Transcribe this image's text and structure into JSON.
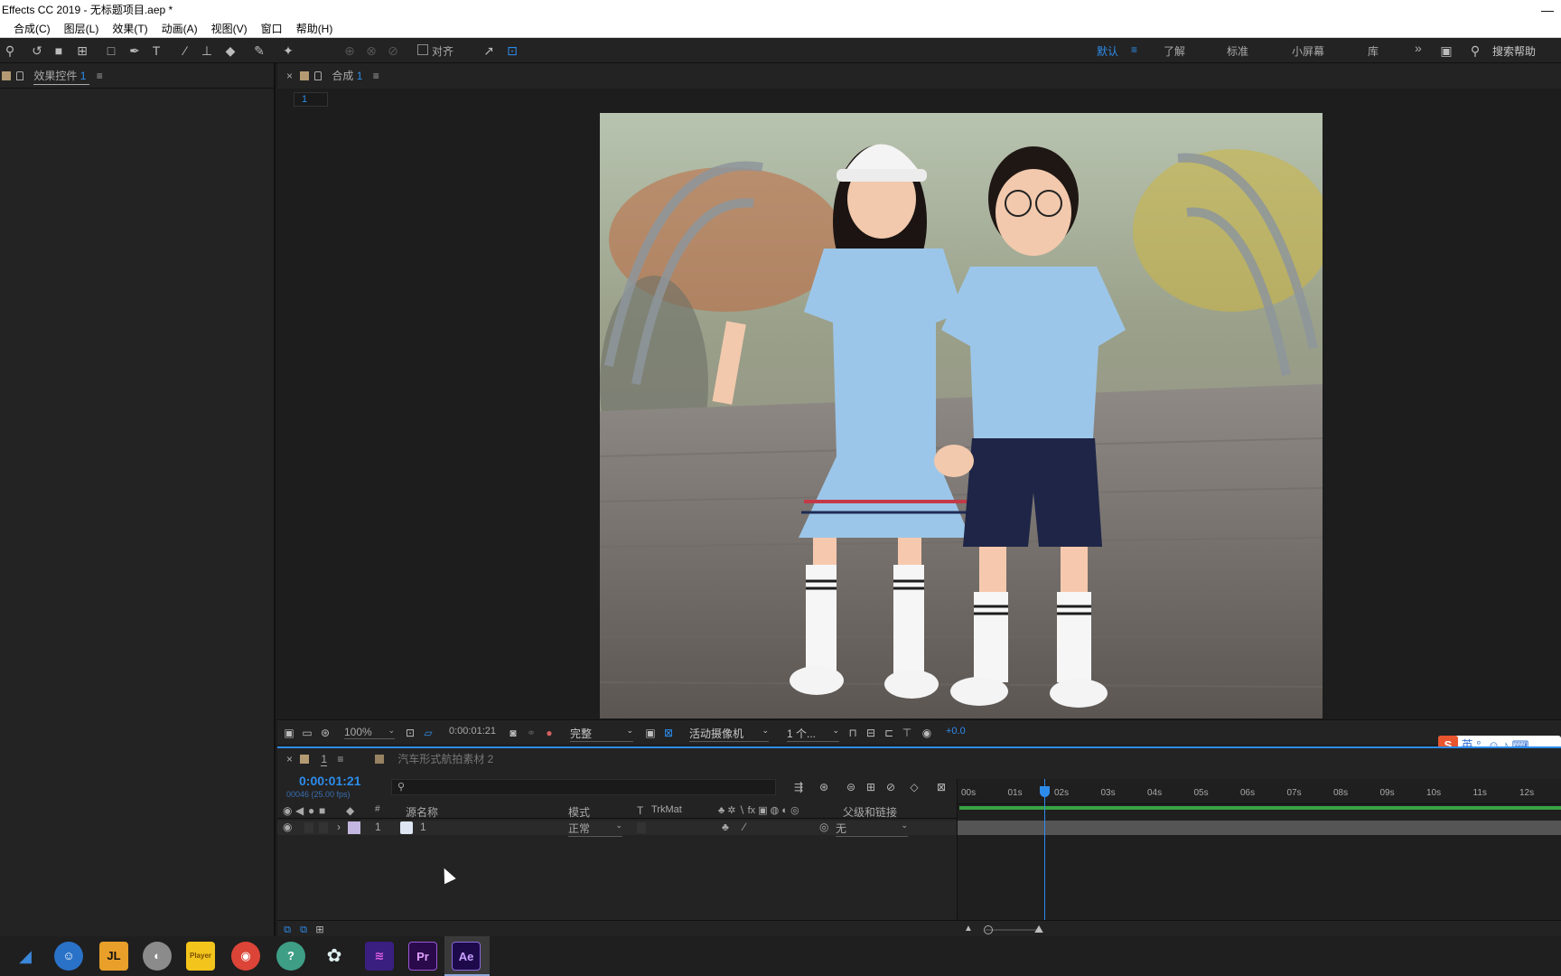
{
  "window": {
    "title": "Effects CC 2019 - 无标题项目.aep *",
    "minimize": "—"
  },
  "menu": [
    "合成(C)",
    "图层(L)",
    "效果(T)",
    "动画(A)",
    "视图(V)",
    "窗口",
    "帮助(H)"
  ],
  "toolbar": {
    "align_label": "对齐",
    "workspaces": [
      "默认",
      "了解",
      "标准",
      "小屏幕",
      "库"
    ],
    "more": "»",
    "search_placeholder": "搜索帮助"
  },
  "left_panel": {
    "tab_label": "效果控件",
    "tab_number": "1",
    "menu": "≡"
  },
  "comp_panel": {
    "close": "×",
    "tab_label": "合成",
    "tab_number": "1",
    "menu": "≡",
    "sub_tab": "1"
  },
  "viewer_bar": {
    "zoom": "100%",
    "timecode": "0:00:01:21",
    "resolution": "完整",
    "camera": "活动摄像机",
    "views": "1 个...",
    "exposure": "+0.0"
  },
  "timeline": {
    "close": "×",
    "tab_number": "1",
    "menu": "≡",
    "other_tab": "汽车形式航拍素材 2",
    "current_time": "0:00:01:21",
    "frame_info": "00046 (25.00 fps)",
    "headers": {
      "hash": "#",
      "source_name": "源名称",
      "mode": "模式",
      "t": "T",
      "trkmat": "TrkMat",
      "parent": "父级和链接"
    },
    "ruler": [
      "00s",
      "01s",
      "02s",
      "03s",
      "04s",
      "05s",
      "06s",
      "07s",
      "08s",
      "09s",
      "10s",
      "11s",
      "12s"
    ],
    "playhead_fraction": 0.143,
    "layers": [
      {
        "index": "1",
        "name": "1",
        "mode": "正常",
        "parent": "无"
      }
    ]
  },
  "ime": {
    "label": "英",
    "punct": "°,"
  },
  "taskbar_icons": [
    "start-icon",
    "qq-icon",
    "jl-icon",
    "disk-icon",
    "player-icon",
    "chrome-icon",
    "app-icon",
    "flower-icon",
    "media-icon",
    "premiere-icon",
    "aftereffects-icon"
  ],
  "taskbar_labels": {
    "jl": "JL",
    "pr": "Pr",
    "ae": "Ae",
    "player": "Player"
  },
  "colors": {
    "accent": "#2d8ceb",
    "panel": "#232323",
    "bg": "#1d1d1d",
    "layer_label": "#c3b6e0",
    "tab_square": "#b49a72"
  }
}
